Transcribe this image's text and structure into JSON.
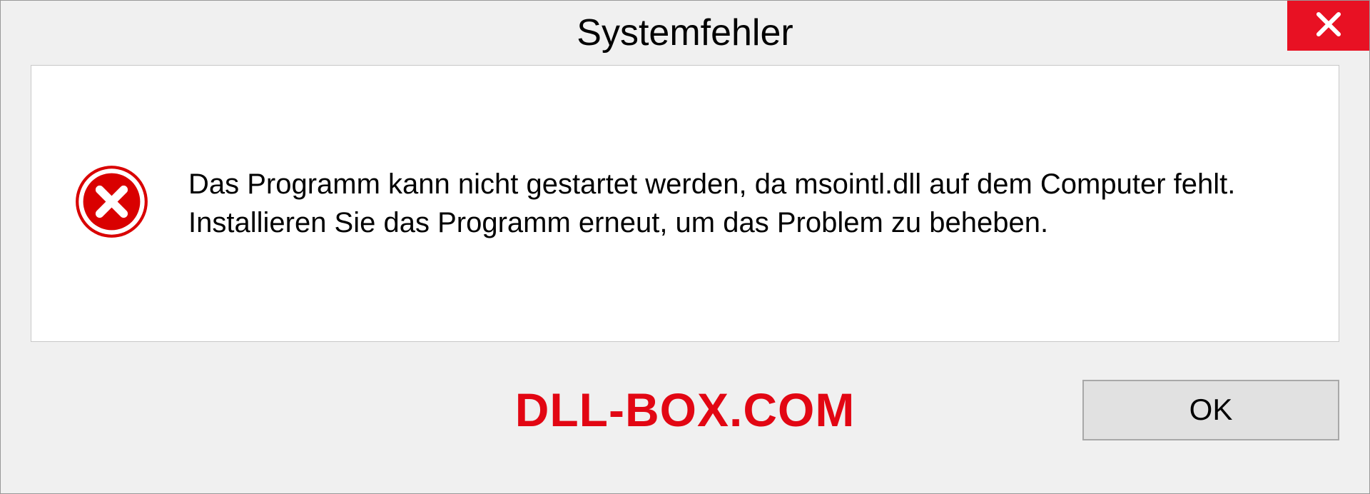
{
  "dialog": {
    "title": "Systemfehler",
    "message": "Das Programm kann nicht gestartet werden, da msointl.dll auf dem Computer fehlt. Installieren Sie das Programm erneut, um das Problem zu beheben.",
    "ok_label": "OK"
  },
  "watermark": "DLL-BOX.COM"
}
